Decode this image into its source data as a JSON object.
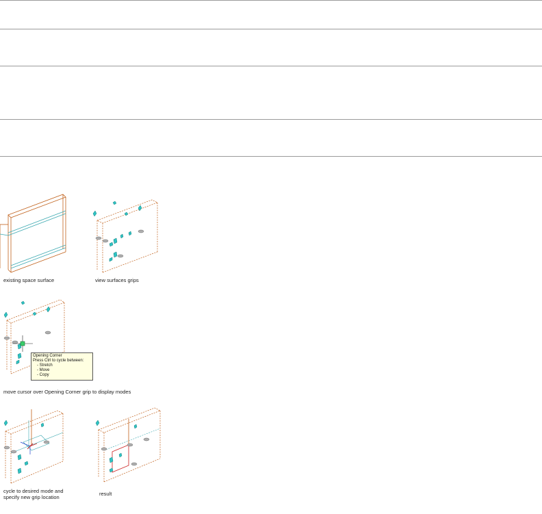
{
  "figure": {
    "panels": [
      {
        "caption": "existing space surface"
      },
      {
        "caption": "view surfaces grips"
      },
      {
        "caption": "move cursor over Opening Corner grip to display modes"
      },
      {
        "caption": "cycle to desired mode and\nspecify new grip location"
      },
      {
        "caption": "result"
      }
    ],
    "tooltip": {
      "title": "Opening Corner",
      "subtitle": "Press Ctrl to cycle between:",
      "options": [
        "- Stretch",
        "- Move",
        "- Copy"
      ]
    }
  },
  "colors": {
    "rule": "#9a9a9a",
    "edge_orange": "#c0601a",
    "edge_cyan": "#3aa8b0",
    "grip_fill": "#2fc4c4",
    "grip_gray": "#9a9a9a",
    "tooltip_bg": "#ffffe1"
  }
}
